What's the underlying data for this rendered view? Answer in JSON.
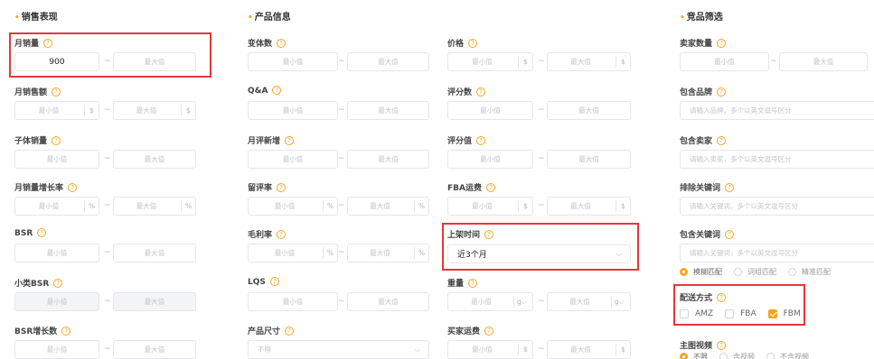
{
  "sections": {
    "sales": "销售表现",
    "product": "产品信息",
    "competitor": "竞品筛选"
  },
  "common": {
    "min": "最小值",
    "max": "最大值",
    "tilde": "~",
    "dollar": "$",
    "percent": "%",
    "gram": "g"
  },
  "sales": {
    "monthly_sales": {
      "label": "月销量",
      "min_value": "900"
    },
    "monthly_revenue": {
      "label": "月销售额"
    },
    "child_sales": {
      "label": "子体销量"
    },
    "sales_growth": {
      "label": "月销量增长率"
    },
    "bsr": {
      "label": "BSR"
    },
    "sub_bsr": {
      "label": "小类BSR"
    },
    "bsr_growth": {
      "label": "BSR增长数"
    }
  },
  "product": {
    "variants": {
      "label": "变体数"
    },
    "qa": {
      "label": "Q&A"
    },
    "new_reviews": {
      "label": "月评新增"
    },
    "review_rate": {
      "label": "留评率"
    },
    "gross_margin": {
      "label": "毛利率"
    },
    "lqs": {
      "label": "LQS"
    },
    "size": {
      "label": "产品尺寸",
      "value": "不限"
    },
    "price": {
      "label": "价格"
    },
    "review_count": {
      "label": "评分数"
    },
    "rating": {
      "label": "评分值"
    },
    "fba_fee": {
      "label": "FBA运费"
    },
    "launch_time": {
      "label": "上架时间",
      "value": "近3个月"
    },
    "weight": {
      "label": "重量"
    },
    "buyer_shipping": {
      "label": "买家运费"
    }
  },
  "competitor": {
    "seller_count": {
      "label": "卖家数量"
    },
    "brand": {
      "label": "包含品牌",
      "placeholder": "请输入品牌，多个以英文逗号区分"
    },
    "seller": {
      "label": "包含卖家",
      "placeholder": "请输入卖家，多个以英文逗号区分"
    },
    "exclude_kw": {
      "label": "排除关键词",
      "placeholder": "请输入关键词，多个以英文逗号区分"
    },
    "include_kw": {
      "label": "包含关键词",
      "placeholder": "请输入关键词，多个以英文逗号区分"
    },
    "match": [
      "模糊匹配",
      "词组匹配",
      "精准匹配"
    ],
    "fulfillment": {
      "label": "配送方式",
      "options": [
        "AMZ",
        "FBA",
        "FBM"
      ]
    },
    "video": {
      "label": "主图视频",
      "options": [
        "不限",
        "含视频",
        "不含视频"
      ]
    }
  },
  "colors": {
    "accent": "#f5a623",
    "highlight": "#e8363a"
  }
}
